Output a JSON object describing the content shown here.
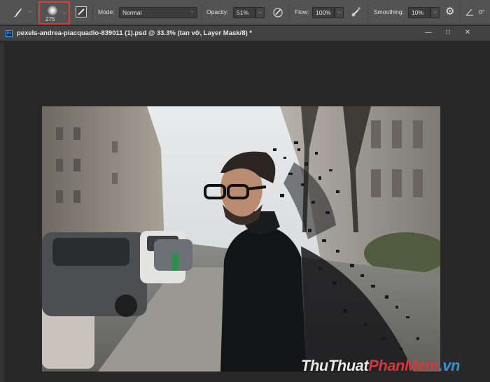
{
  "options_bar": {
    "brush_size": "275",
    "mode_label": "Mode:",
    "mode_value": "Normal",
    "opacity_label": "Opacity:",
    "opacity_value": "51%",
    "flow_label": "Flow:",
    "flow_value": "100%",
    "smoothing_label": "Smoothing:",
    "smoothing_value": "10%",
    "angle_value": "0°",
    "highlight_color": "#e03a3a"
  },
  "document": {
    "tab_icon": "Ps",
    "title": "pexels-andrea-piacquadio-839011 (1).psd @ 33.3% (tan vỡ, Layer Mask/8) *"
  },
  "watermark": {
    "part1": "ThuThuat",
    "part2": "PhanMem",
    "part3": ".vn"
  },
  "icons": [
    "brush-tool-icon",
    "brush-preset-icon",
    "brush-settings-panel-icon",
    "pressure-opacity-icon",
    "airbrush-icon",
    "smoothing-settings-gear-icon",
    "angle-icon",
    "photoshop-doc-icon",
    "minimize-icon",
    "maximize-icon",
    "close-icon"
  ]
}
